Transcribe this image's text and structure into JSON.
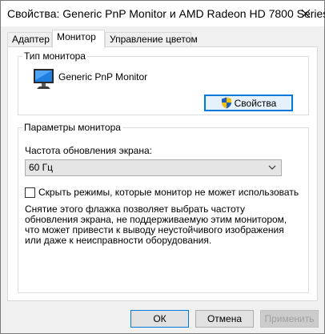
{
  "window": {
    "title": "Свойства: Generic PnP Monitor и AMD Radeon HD 7800 Series"
  },
  "tabs": [
    {
      "label": "Адаптер",
      "active": false
    },
    {
      "label": "Монитор",
      "active": true
    },
    {
      "label": "Управление цветом",
      "active": false
    }
  ],
  "monitor_type": {
    "group_label": "Тип монитора",
    "monitor_name": "Generic PnP Monitor",
    "properties_button": "Свойства"
  },
  "monitor_settings": {
    "group_label": "Параметры монитора",
    "refresh_label": "Частота обновления экрана:",
    "refresh_value": "60 Гц",
    "hide_modes_label": "Скрыть режимы, которые монитор не может использовать",
    "hide_modes_checked": false,
    "description": "Снятие этого флажка позволяет выбрать частоту обновления экрана, не поддерживаемую этим монитором, что может привести к выводу неустойчивого изображения или даже к неисправности оборудования."
  },
  "footer": {
    "ok": "ОК",
    "cancel": "Отмена",
    "apply": "Применить"
  },
  "colors": {
    "accent": "#0078d7",
    "shield_blue": "#1f5fbf",
    "shield_yellow": "#f2c200"
  },
  "icons": {
    "close": "close-icon",
    "monitor": "monitor-icon",
    "shield": "shield-icon",
    "dropdown": "chevron-down-icon"
  }
}
